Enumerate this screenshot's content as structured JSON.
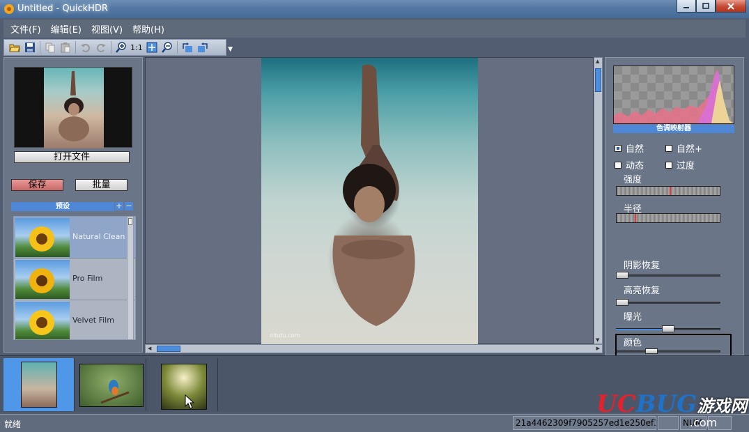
{
  "window": {
    "title": "Untitled - QuickHDR",
    "minimize_icon": "minimize-icon",
    "maximize_icon": "maximize-icon",
    "close_icon": "close-icon"
  },
  "menu": [
    "文件(F)",
    "编辑(E)",
    "视图(V)",
    "帮助(H)"
  ],
  "toolbar": {
    "actual_size_label": "1:1",
    "icons": [
      "open-folder-icon",
      "save-icon",
      "copy-icon",
      "paste-icon",
      "undo-icon",
      "redo-icon",
      "zoom-in-icon",
      "fit-window-icon",
      "zoom-out-icon",
      "rotate-left-icon",
      "rotate-right-icon"
    ]
  },
  "left_panel": {
    "open_file_button": "打开文件",
    "save_button": "保存",
    "batch_button": "批量",
    "presets_header": "预设",
    "add_preset": "+",
    "remove_preset": "−",
    "presets": [
      {
        "label": "Natural Clean",
        "selected": true
      },
      {
        "label": "Pro Film",
        "selected": false
      },
      {
        "label": "Velvet Film",
        "selected": false
      }
    ]
  },
  "canvas": {
    "watermark": "nitutu.com"
  },
  "right_panel": {
    "section_title": "色调映射器",
    "options": {
      "natural": "自然",
      "natural_plus": "自然+",
      "dynamic": "动态",
      "excessive": "过度"
    },
    "selected_option": "natural",
    "strength_label": "强度",
    "radius_label": "半径",
    "shadow_recovery_label": "阴影恢复",
    "highlight_recovery_label": "高亮恢复",
    "exposure_label": "曝光",
    "color_label": "颜色",
    "strength_level": 0.52,
    "radius_level": 0.18,
    "shadow_recovery_level": 0.0,
    "highlight_recovery_level": 0.0,
    "exposure_level": 0.5,
    "color_level": 0.32
  },
  "status": {
    "text": "就绪",
    "hash": "21a4462309f7905257ed1e250ef3d",
    "numlock": "NUM"
  },
  "brand": {
    "u": "UC",
    "bug": "BUG",
    "cn": "游戏网",
    "com": ".com"
  },
  "colors": {
    "accent": "#4d87d6",
    "filmstrip_active": "#4f97e8",
    "save_button": "#d97c7c"
  }
}
